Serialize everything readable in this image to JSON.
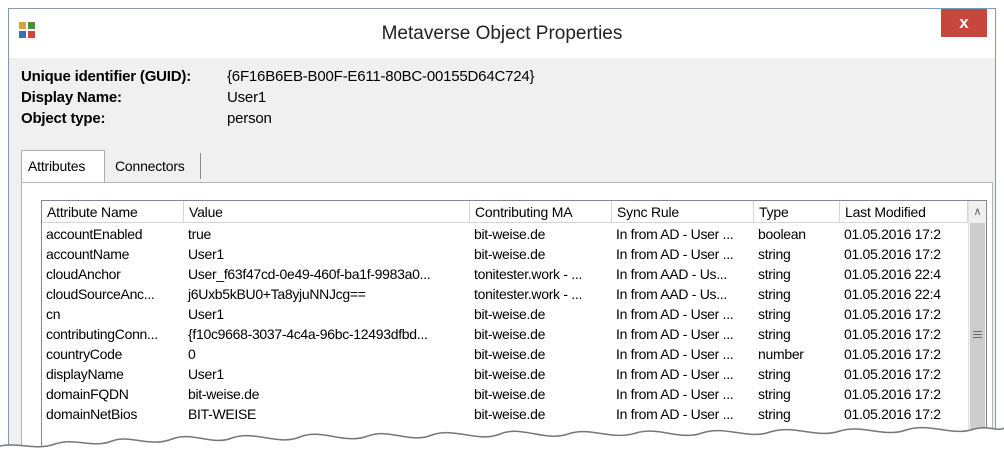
{
  "window": {
    "title": "Metaverse Object Properties",
    "close_label": "x",
    "accent_close": "#c7463d"
  },
  "info": [
    {
      "label": "Unique identifier (GUID):",
      "value": "{6F16B6EB-B00F-E611-80BC-00155D64C724}"
    },
    {
      "label": "Display Name:",
      "value": "User1"
    },
    {
      "label": "Object type:",
      "value": "person"
    }
  ],
  "tabs": [
    {
      "label": "Attributes",
      "active": true
    },
    {
      "label": "Connectors",
      "active": false
    }
  ],
  "grid": {
    "columns": [
      "Attribute Name",
      "Value",
      "Contributing MA",
      "Sync Rule",
      "Type",
      "Last Modified"
    ],
    "rows": [
      [
        "accountEnabled",
        "true",
        "bit-weise.de",
        "In from AD - User ...",
        "boolean",
        "01.05.2016 17:2"
      ],
      [
        "accountName",
        "User1",
        "bit-weise.de",
        "In from AD - User ...",
        "string",
        "01.05.2016 17:2"
      ],
      [
        "cloudAnchor",
        "User_f63f47cd-0e49-460f-ba1f-9983a0...",
        "tonitester.work - ...",
        "In from AAD - Us...",
        "string",
        "01.05.2016 22:4"
      ],
      [
        "cloudSourceAnc...",
        "j6Uxb5kBU0+Ta8yjuNNJcg==",
        "tonitester.work - ...",
        "In from AAD - Us...",
        "string",
        "01.05.2016 22:4"
      ],
      [
        "cn",
        "User1",
        "bit-weise.de",
        "In from AD - User ...",
        "string",
        "01.05.2016 17:2"
      ],
      [
        "contributingConn...",
        "{f10c9668-3037-4c4a-96bc-12493dfbd...",
        "bit-weise.de",
        "In from AD - User ...",
        "string",
        "01.05.2016 17:2"
      ],
      [
        "countryCode",
        "0",
        "bit-weise.de",
        "In from AD - User ...",
        "number",
        "01.05.2016 17:2"
      ],
      [
        "displayName",
        "User1",
        "bit-weise.de",
        "In from AD - User ...",
        "string",
        "01.05.2016 17:2"
      ],
      [
        "domainFQDN",
        "bit-weise.de",
        "bit-weise.de",
        "In from AD - User ...",
        "string",
        "01.05.2016 17:2"
      ],
      [
        "domainNetBios",
        "BIT-WEISE",
        "bit-weise.de",
        "In from AD - User ...",
        "string",
        "01.05.2016 17:2"
      ]
    ]
  }
}
